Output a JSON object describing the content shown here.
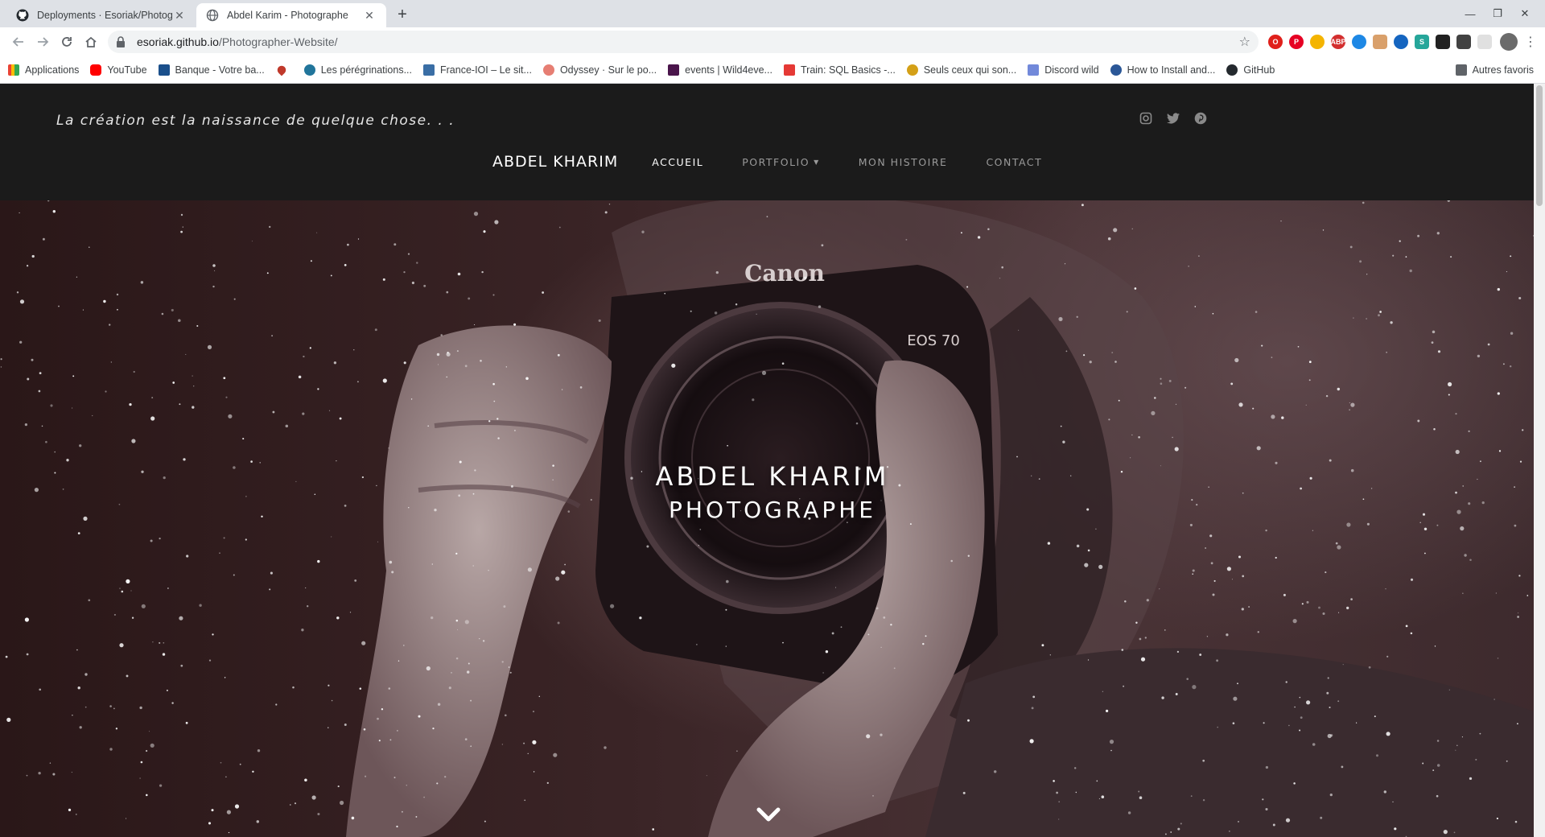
{
  "browser": {
    "tabs": [
      {
        "title": "Deployments · Esoriak/Photogr",
        "active": false
      },
      {
        "title": "Abdel Karim - Photographe",
        "active": true
      }
    ],
    "new_tab": "+",
    "url_host": "esoriak.github.io",
    "url_path": "/Photographer-Website/",
    "bookmarks": [
      {
        "label": "Applications",
        "color": "#4285f4"
      },
      {
        "label": "YouTube",
        "color": "#ff0000"
      },
      {
        "label": "Banque - Votre ba...",
        "color": "#1a4f8b"
      },
      {
        "label": "",
        "color": "#c0392b"
      },
      {
        "label": "Les pérégrinations...",
        "color": "#21759b"
      },
      {
        "label": "France-IOI – Le sit...",
        "color": "#3a6ea5"
      },
      {
        "label": "Odyssey · Sur le po...",
        "color": "#e67e73"
      },
      {
        "label": "events | Wild4eve...",
        "color": "#4a154b"
      },
      {
        "label": "Train: SQL Basics -...",
        "color": "#e53935"
      },
      {
        "label": "Seuls ceux qui son...",
        "color": "#d4a017"
      },
      {
        "label": "Discord wild",
        "color": "#7289da"
      },
      {
        "label": "How to Install and...",
        "color": "#2b5797"
      },
      {
        "label": "GitHub",
        "color": "#24292e"
      }
    ],
    "other_bookmarks": "Autres favoris"
  },
  "site": {
    "tagline": "La création est la naissance de quelque chose. . .",
    "brand": "ABDEL KHARIM",
    "nav": [
      {
        "label": "ACCUEIL",
        "active": true
      },
      {
        "label": "PORTFOLIO",
        "active": false,
        "dropdown": true
      },
      {
        "label": "MON HISTOIRE",
        "active": false
      },
      {
        "label": "CONTACT",
        "active": false
      }
    ],
    "social_icons": [
      "instagram-icon",
      "twitter-icon",
      "pinterest-icon"
    ],
    "hero": {
      "title_line1": "ABDEL KHARIM",
      "title_line2": "PHOTOGRAPHE",
      "camera_brand": "Canon",
      "camera_model": "EOS 70"
    }
  },
  "colors": {
    "header_bg": "#1b1b1b",
    "nav_active": "#ffffff",
    "nav_inactive": "#9a9a9a"
  }
}
